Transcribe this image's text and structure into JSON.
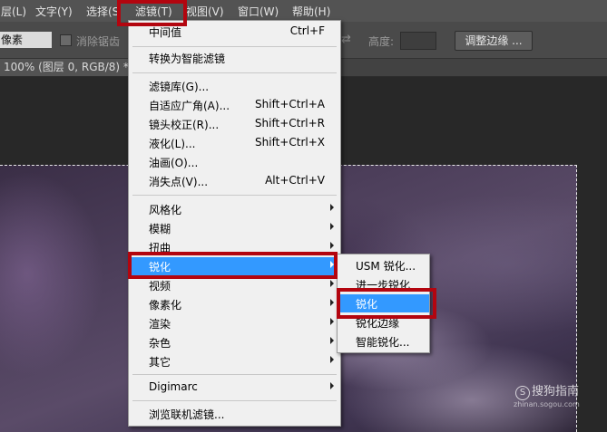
{
  "menubar": {
    "items": [
      "层(L)",
      "文字(Y)",
      "选择(S",
      "滤镜(T)",
      "视图(V)",
      "窗口(W)",
      "帮助(H)"
    ]
  },
  "options_bar": {
    "unit": "像素",
    "antialias_label": "消除锯齿",
    "height_label": "高度:",
    "refine_edge_button": "调整边缘 ..."
  },
  "document_tab": {
    "title": "100% (图层 0, RGB/8) *"
  },
  "filter_menu": {
    "items": [
      {
        "label": "中间值",
        "shortcut": "Ctrl+F"
      },
      {
        "label": "转换为智能滤镜",
        "shortcut": ""
      },
      {
        "label": "滤镜库(G)...",
        "shortcut": ""
      },
      {
        "label": "自适应广角(A)...",
        "shortcut": "Shift+Ctrl+A"
      },
      {
        "label": "镜头校正(R)...",
        "shortcut": "Shift+Ctrl+R"
      },
      {
        "label": "液化(L)...",
        "shortcut": "Shift+Ctrl+X"
      },
      {
        "label": "油画(O)...",
        "shortcut": ""
      },
      {
        "label": "消失点(V)...",
        "shortcut": "Alt+Ctrl+V"
      },
      {
        "label": "风格化",
        "shortcut": ""
      },
      {
        "label": "模糊",
        "shortcut": ""
      },
      {
        "label": "扭曲",
        "shortcut": ""
      },
      {
        "label": "锐化",
        "shortcut": ""
      },
      {
        "label": "视频",
        "shortcut": ""
      },
      {
        "label": "像素化",
        "shortcut": ""
      },
      {
        "label": "渲染",
        "shortcut": ""
      },
      {
        "label": "杂色",
        "shortcut": ""
      },
      {
        "label": "其它",
        "shortcut": ""
      },
      {
        "label": "Digimarc",
        "shortcut": ""
      },
      {
        "label": "浏览联机滤镜...",
        "shortcut": ""
      }
    ]
  },
  "sharpen_submenu": {
    "items": [
      "USM 锐化...",
      "进一步锐化",
      "锐化",
      "锐化边缘",
      "智能锐化..."
    ]
  },
  "watermark": {
    "brand": "搜狗指南",
    "logo_letter": "S",
    "url": "zhinan.sogou.com"
  },
  "colors": {
    "highlight": "#3399ff",
    "annotation_red": "#b3050f",
    "menubar_bg": "#535353",
    "menu_bg": "#f0f0f0"
  }
}
